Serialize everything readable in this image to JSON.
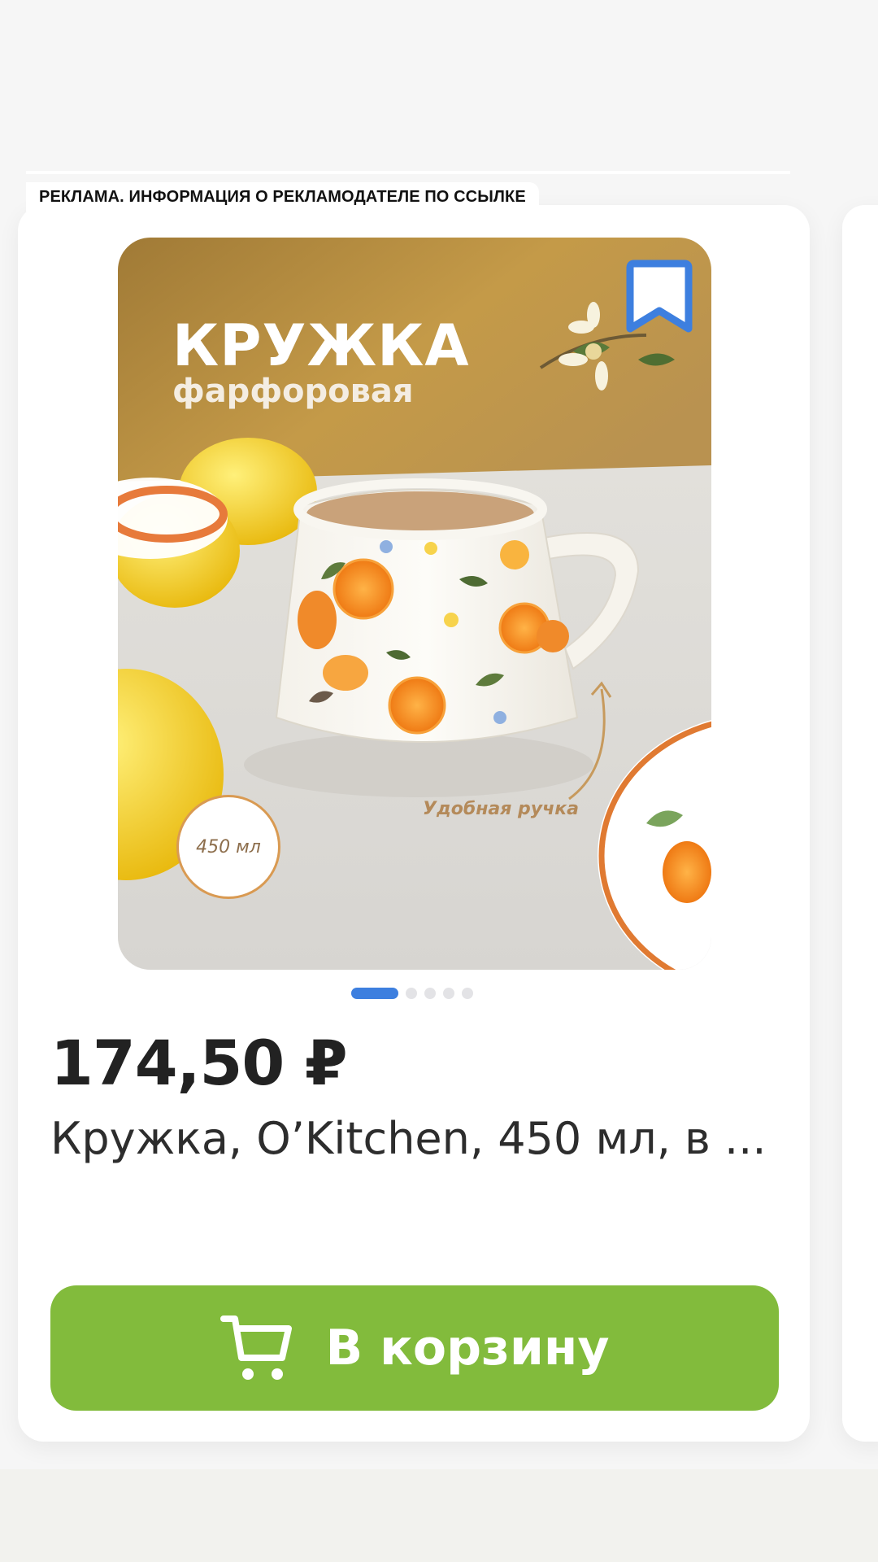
{
  "ad_disclaimer": "РЕКЛАМА. ИНФОРМАЦИЯ О РЕКЛАМОДАТЕЛЕ ПО ССЫЛКЕ",
  "product": {
    "image": {
      "promo_title": "КРУЖКА",
      "promo_subtitle": "фарфоровая",
      "volume_badge": "450 мл",
      "handle_caption": "Удобная ручка"
    },
    "gallery": {
      "total_images": 5,
      "current_index": 1
    },
    "price": "174,50 ₽",
    "title": "Кружка, O’Kitchen, 450 мл, в ...",
    "favorite_icon": "bookmark-icon"
  },
  "cart_button": {
    "label": "В корзину",
    "icon": "shopping-cart-icon"
  },
  "colors": {
    "accent_green": "#82bb3c",
    "accent_blue": "#3d7fdf",
    "price_text": "#222222",
    "background": "#f6f6f6"
  }
}
